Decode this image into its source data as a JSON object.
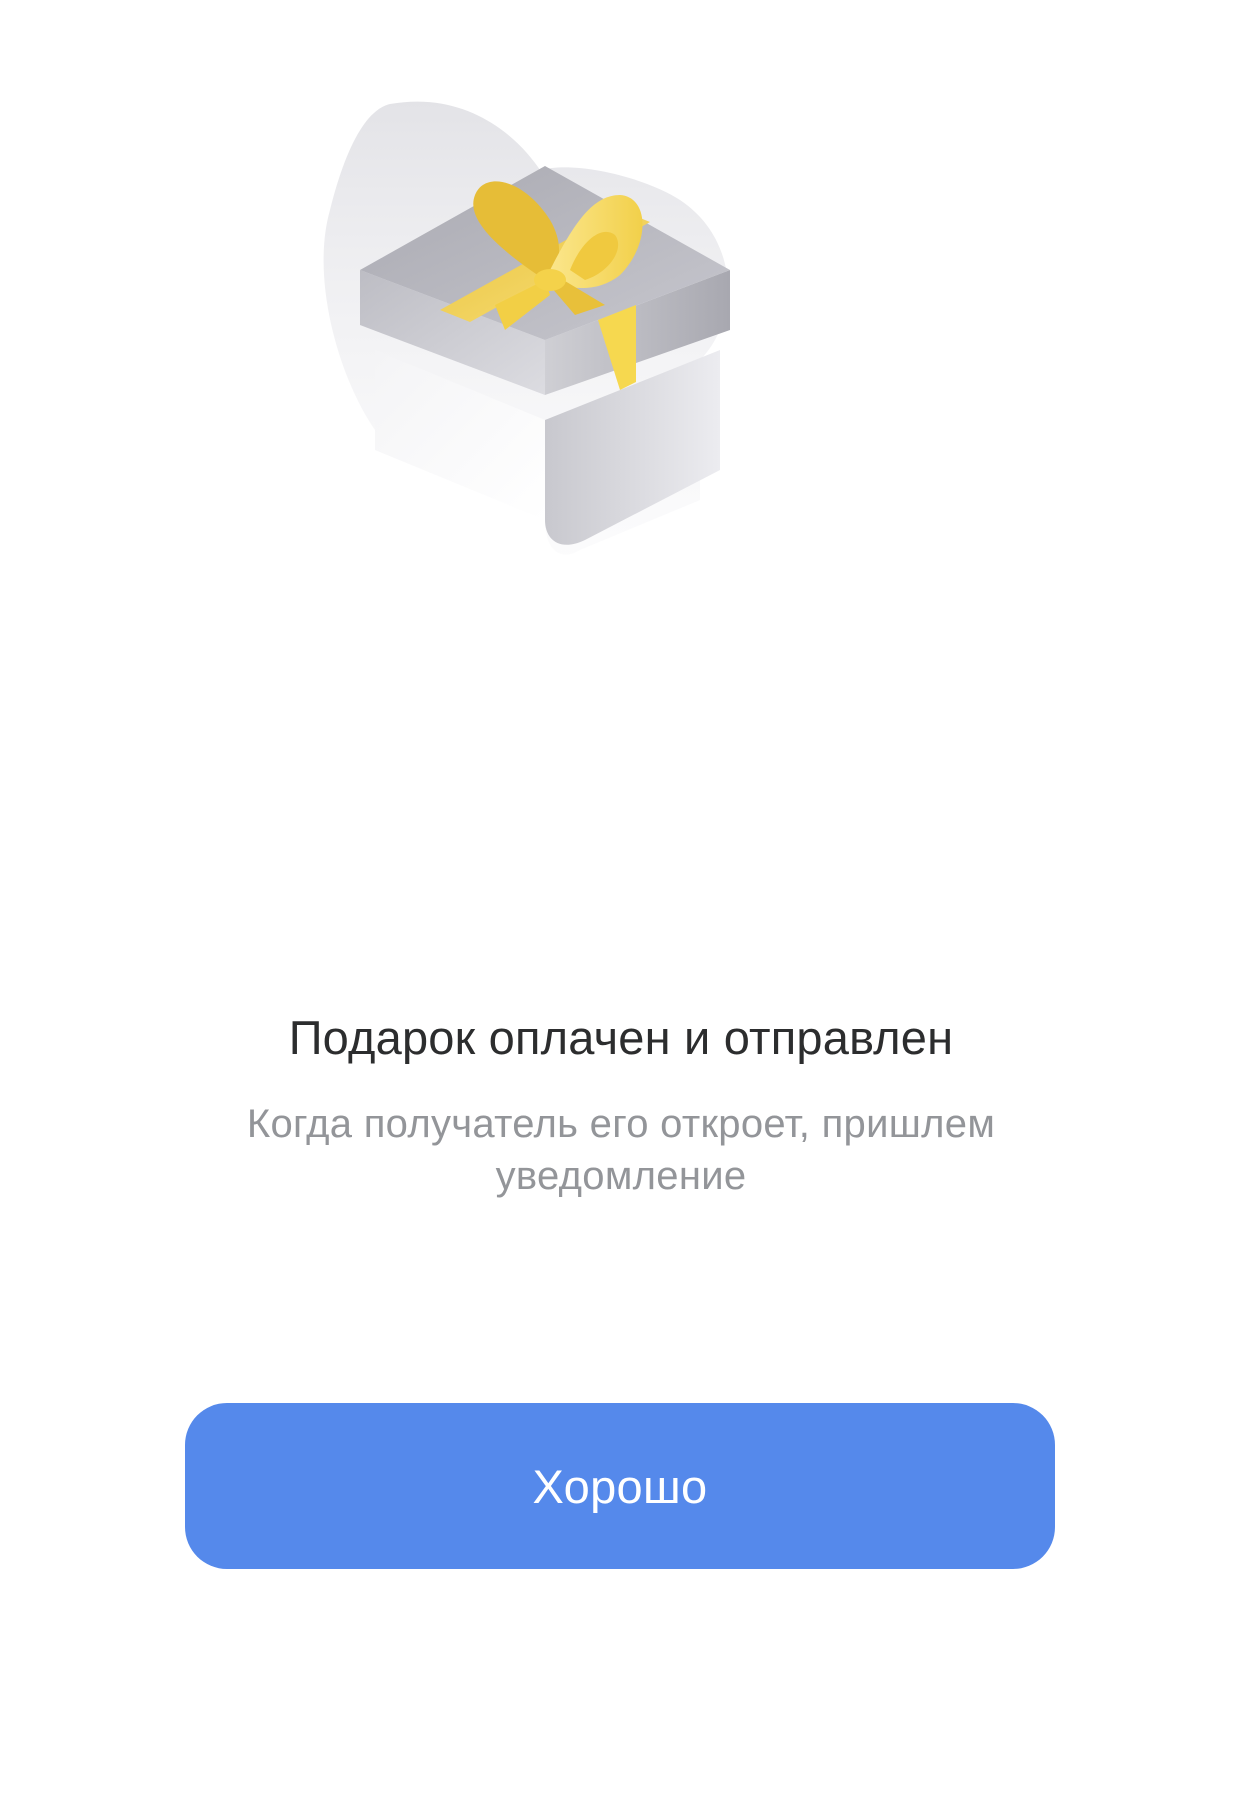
{
  "dialog": {
    "illustration_icon": "gift-box-icon",
    "title": "Подарок оплачен и отправлен",
    "subtitle": "Когда получатель его откроет, пришлем уведомление",
    "ok_button_label": "Хорошо"
  },
  "colors": {
    "background": "#ffffff",
    "title": "#2c2d2e",
    "subtitle": "#939599",
    "button": "#5589eb",
    "button_text": "#ffffff",
    "ribbon": "#f5d44a",
    "box": "#c9c9cf"
  }
}
